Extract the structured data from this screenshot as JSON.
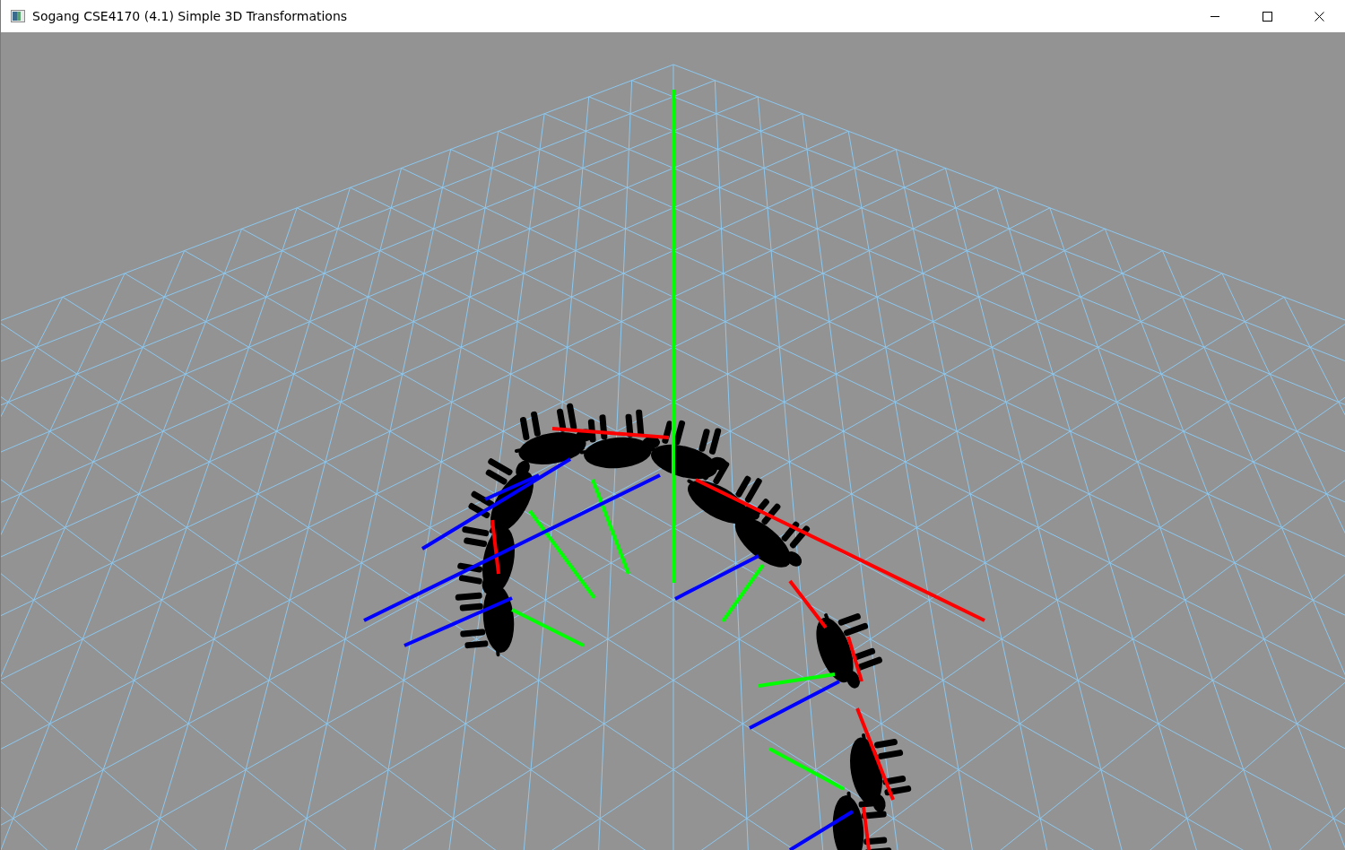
{
  "window": {
    "title": "Sogang CSE4170 (4.1) Simple 3D Transformations"
  }
}
